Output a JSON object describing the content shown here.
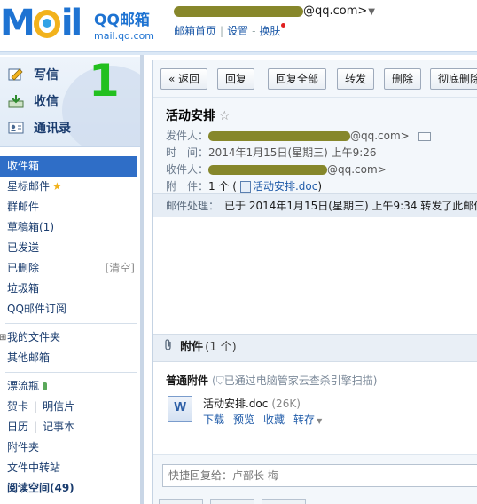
{
  "header": {
    "brand_name": "QQ邮箱",
    "brand_url": "mail.qq.com",
    "account_suffix": "@qq.com>",
    "links": [
      "邮箱首页",
      "设置",
      "换肤"
    ]
  },
  "sidebar": {
    "annotation_digit": "1",
    "actions": [
      {
        "label": "写信",
        "icon": "compose-icon"
      },
      {
        "label": "收信",
        "icon": "inbox-download-icon"
      },
      {
        "label": "通讯录",
        "icon": "contacts-icon"
      }
    ],
    "folders": [
      {
        "label": "收件箱",
        "active": true
      },
      {
        "label": "星标邮件"
      },
      {
        "label": "群邮件"
      },
      {
        "label": "草稿箱(1)"
      },
      {
        "label": "已发送"
      },
      {
        "label": "已删除",
        "extra": "[清空]"
      },
      {
        "label": "垃圾箱"
      },
      {
        "label": "QQ邮件订阅"
      }
    ],
    "my_folders_label": "我的文件夹",
    "other_mailbox_label": "其他邮箱",
    "apps": {
      "drift_bottle": "漂流瓶",
      "greeting_card": "贺卡",
      "postcard": "明信片",
      "calendar": "日历",
      "notebook": "记事本",
      "attachments": "附件夹",
      "file_transfer": "文件中转站",
      "reading_space": "阅读空间(49)"
    }
  },
  "toolbar": {
    "back_label": "« 返回",
    "reply_label": "回复",
    "reply_all_label": "回复全部",
    "forward_label": "转发",
    "delete_label": "删除",
    "perm_delete_label": "彻底删除"
  },
  "mail": {
    "subject": "活动安排",
    "star_glyph": "☆",
    "from_label": "发件人：",
    "from_suffix": "@qq.com>",
    "time_label": "时　间：",
    "time_value": "2014年1月15日(星期三) 上午9:26",
    "to_label": "收件人：",
    "to_suffix": "@qq.com>",
    "attach_label": "附　件：",
    "attach_count": "1 个 (",
    "attach_file": "活动安排.doc",
    "attach_close": ")",
    "processing_label": "邮件处理：",
    "processing_note": "已于 2014年1月15日(星期三) 上午9:34 转发了此邮件"
  },
  "attachments": {
    "section_title": "附件",
    "section_count": "(1 个)",
    "kind_label": "普通附件",
    "scan_note": "已通过电脑管家云查杀引擎扫描)",
    "file_name": "活动安排.doc",
    "file_size": "(26K)",
    "actions": [
      "下载",
      "预览",
      "收藏",
      "转存"
    ]
  },
  "reply": {
    "placeholder": "快捷回复给：卢部长 梅"
  }
}
